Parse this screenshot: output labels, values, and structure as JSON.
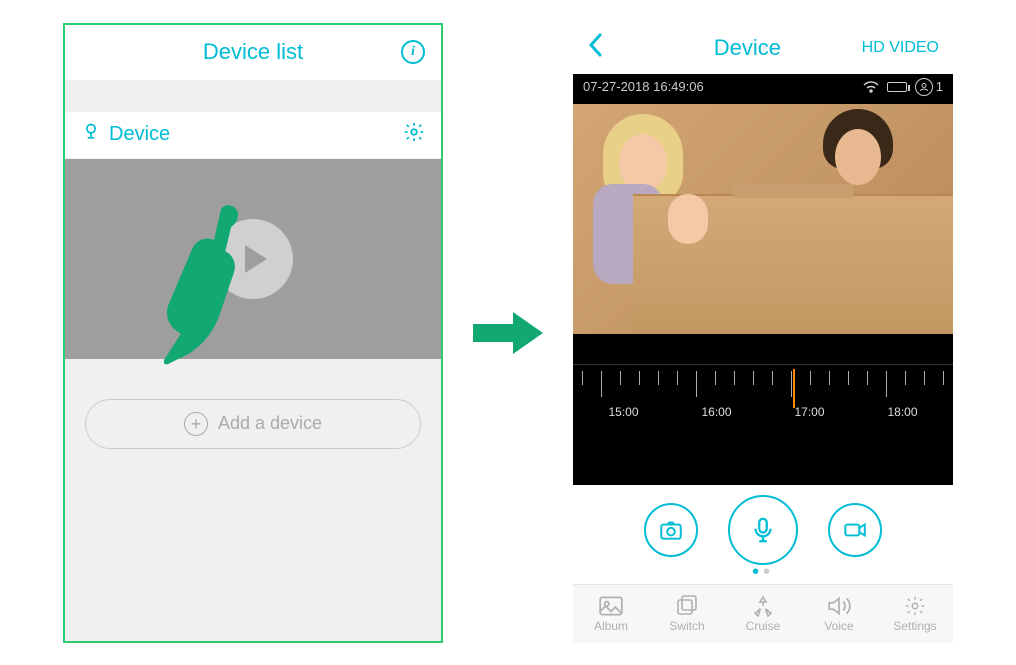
{
  "left": {
    "title": "Device list",
    "device_label": "Device",
    "add_label": "Add a device"
  },
  "right": {
    "title": "Device",
    "quality": "HD VIDEO",
    "timestamp": "07-27-2018 16:49:06",
    "user_count": "1",
    "timeline": {
      "labels": [
        "15:00",
        "16:00",
        "17:00",
        "18:00"
      ]
    },
    "tabs": {
      "album": "Album",
      "switch": "Switch",
      "cruise": "Cruise",
      "voice": "Voice",
      "settings": "Settings"
    }
  }
}
